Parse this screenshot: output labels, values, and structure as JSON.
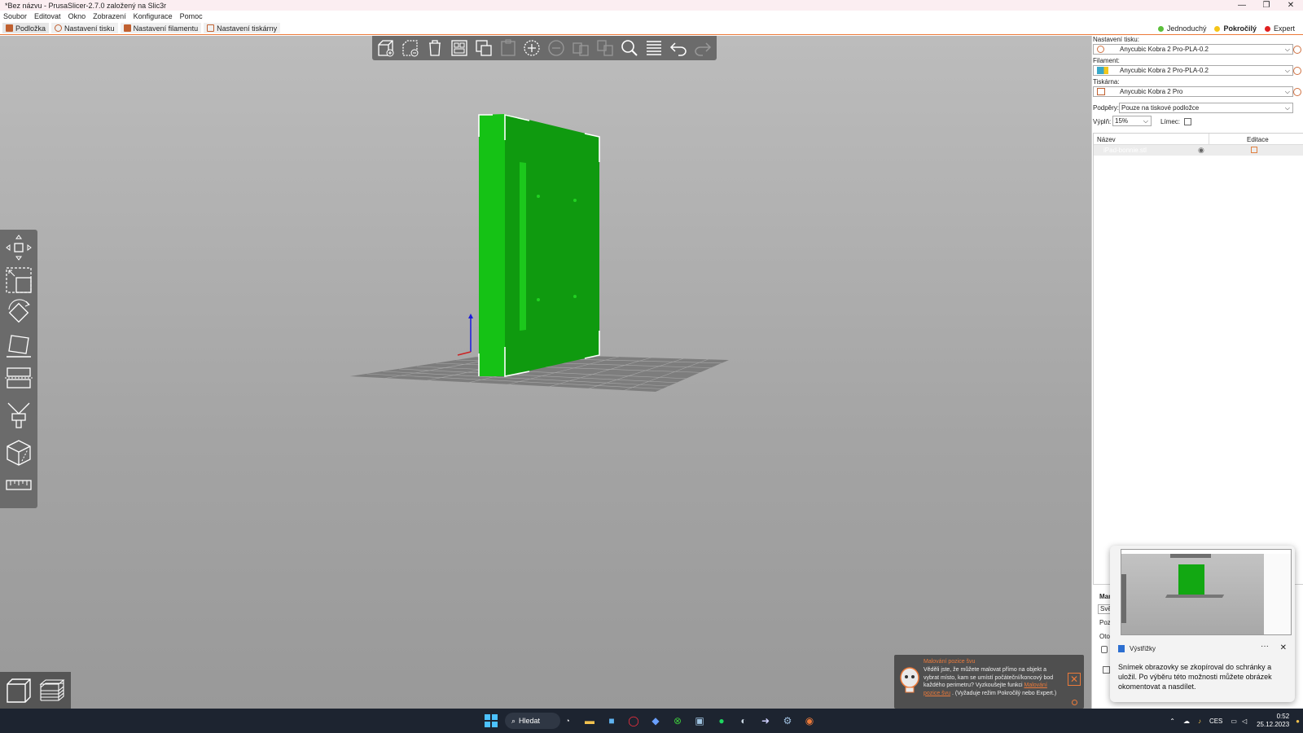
{
  "window": {
    "title": "*Bez názvu - PrusaSlicer-2.7.0 založený na Slic3r",
    "minimize": "—",
    "maximize": "❐",
    "close": "✕"
  },
  "menu": [
    "Soubor",
    "Editovat",
    "Okno",
    "Zobrazení",
    "Konfigurace",
    "Pomoc"
  ],
  "tabs": [
    "Podložka",
    "Nastavení tisku",
    "Nastavení filamentu",
    "Nastavení tiskárny"
  ],
  "modes": [
    {
      "label": "Jednoduchý",
      "color": "#5bbf3a"
    },
    {
      "label": "Pokročilý",
      "color": "#f5c518"
    },
    {
      "label": "Expert",
      "color": "#e02020"
    }
  ],
  "panel": {
    "print_settings_label": "Nastavení tisku:",
    "print_settings_value": "Anycubic Kobra 2 Pro-PLA-0.2",
    "filament_label": "Filament:",
    "filament_value": "Anycubic Kobra 2 Pro-PLA-0.2",
    "printer_label": "Tiskárna:",
    "printer_value": "Anycubic Kobra 2 Pro",
    "supports_label": "Podpěry:",
    "supports_value": "Pouze na tiskové podložce",
    "infill_label": "Výplň:",
    "infill_value": "15%",
    "brim_label": "Límec:",
    "col_name": "Název",
    "col_edit": "Editace",
    "object_name": "iPad-bonnie.stl",
    "manip_lines": [
      "Mani",
      "Svět",
      "Pozic",
      "Otoč"
    ]
  },
  "snip": {
    "app": "Výstřižky",
    "more": "···",
    "close": "✕",
    "message": "Snímek obrazovky se zkopíroval do schránky a uložil. Po výběru této možnosti můžete obrázek okomentovat a nasdílet."
  },
  "hint": {
    "title": "Malování pozice švu",
    "text": "Věděli jste, že můžete malovat přímo na objekt a vybrat místo, kam se umístí počáteční/koncový bod každého perimetru? Vyzkoušejte funkci",
    "link": "Malování pozice švu",
    "suffix": ". (Vyžaduje režim Pokročilý nebo Expert.)",
    "close": "✕"
  },
  "taskbar": {
    "search": "Hledat",
    "lang": "CES",
    "time": "0:52",
    "date": "25.12.2023"
  },
  "colors": {
    "accent": "#ec7a3a",
    "model_green": "#12a812",
    "viewport_bg": "#b0b0b0"
  }
}
